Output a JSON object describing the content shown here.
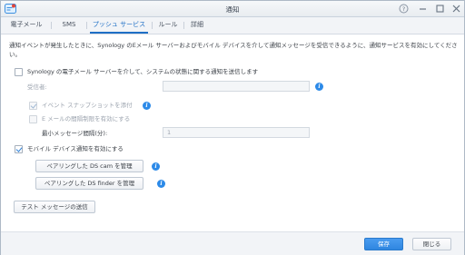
{
  "window": {
    "title": "通知"
  },
  "tabs": [
    {
      "label": "電子メール"
    },
    {
      "label": "SMS"
    },
    {
      "label": "プッシュ サービス",
      "active": true
    },
    {
      "label": "ルール"
    },
    {
      "label": "詳細"
    }
  ],
  "description": "通知イベントが発生したときに、Synology のEメール サーバーおよびモバイル デバイスを介して通知メッセージを受信できるように、通知サービスを有効にしてください。",
  "form": {
    "send_email_server": {
      "label": "Synology の電子メール サーバーを介して、システムの状態に関する通知を送信します",
      "checked": false
    },
    "recipient": {
      "label": "受信者:",
      "value": ""
    },
    "attach_snapshot": {
      "label": "イベント スナップショットを添付",
      "checked": true,
      "disabled": true
    },
    "email_interval": {
      "label": "E メールの間隔制限を有効にする",
      "checked": false,
      "disabled": true
    },
    "min_interval": {
      "label": "最小メッセージ間隔(分):",
      "value": "1"
    },
    "mobile_notify": {
      "label": "モバイル デバイス通知を有効にする",
      "checked": true
    },
    "manage_ds_cam": "ペアリングした DS cam を管理",
    "manage_ds_finder": "ペアリングした DS finder を管理",
    "test_message": "テスト メッセージの送信"
  },
  "footer": {
    "save": "保存",
    "close": "閉じる"
  },
  "colors": {
    "accent": "#1f6fc5",
    "primary_button": "#2f86e0",
    "info_icon": "#2c8ae8"
  },
  "icons": {
    "info": "i"
  }
}
